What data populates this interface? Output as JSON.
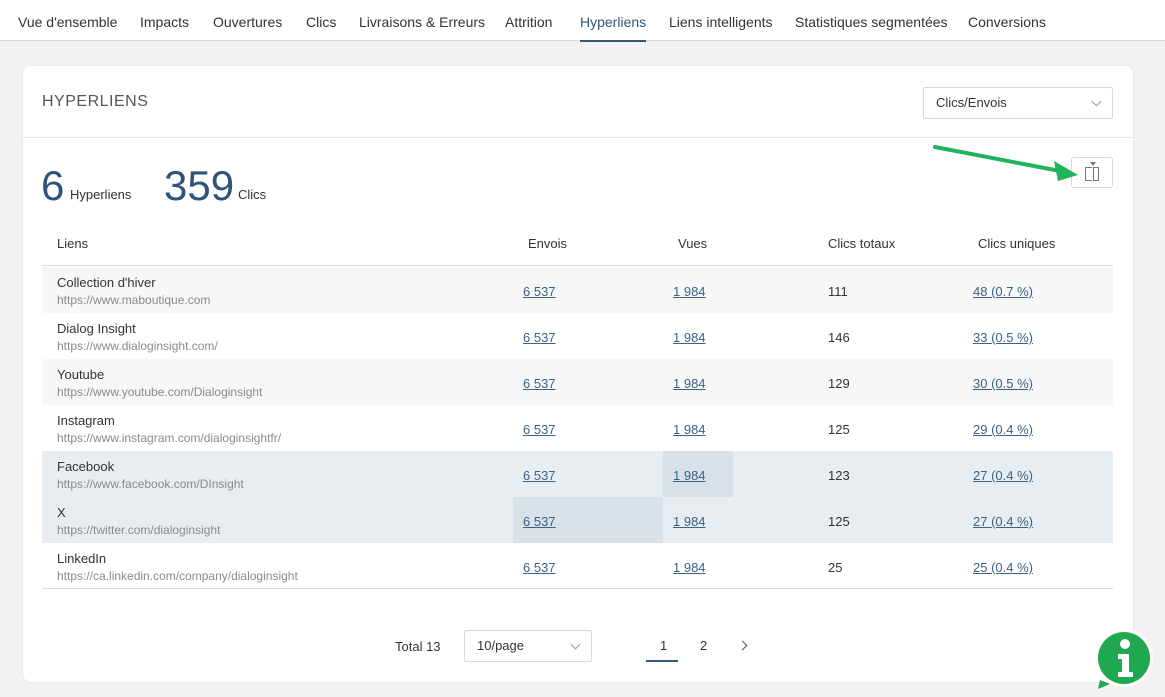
{
  "nav": {
    "tabs": [
      {
        "label": "Vue d'ensemble"
      },
      {
        "label": "Impacts"
      },
      {
        "label": "Ouvertures"
      },
      {
        "label": "Clics"
      },
      {
        "label": "Livraisons & Erreurs"
      },
      {
        "label": "Attrition"
      },
      {
        "label": "Hyperliens"
      },
      {
        "label": "Liens intelligents"
      },
      {
        "label": "Statistiques segmentées"
      },
      {
        "label": "Conversions"
      }
    ],
    "active_tab": "Hyperliens"
  },
  "panel": {
    "title": "HYPERLIENS",
    "metric_select": "Clics/Envois",
    "column_button_icon": "columns-icon"
  },
  "stats": {
    "links_count": "6",
    "links_label": "Hyperliens",
    "clicks_count": "359",
    "clicks_label": "Clics"
  },
  "table": {
    "headers": {
      "links": "Liens",
      "sends": "Envois",
      "views": "Vues",
      "total_clicks": "Clics totaux",
      "unique_clicks": "Clics uniques"
    },
    "rows": [
      {
        "name": "Collection d'hiver",
        "url": "https://www.maboutique.com",
        "sends": "6 537",
        "views": "1 984",
        "total_clicks": "111",
        "unique_clicks": "48 (0.7 %)"
      },
      {
        "name": "Dialog Insight",
        "url": "https://www.dialoginsight.com/",
        "sends": "6 537",
        "views": "1 984",
        "total_clicks": "146",
        "unique_clicks": "33 (0.5 %)"
      },
      {
        "name": "Youtube",
        "url": "https://www.youtube.com/Dialoginsight",
        "sends": "6 537",
        "views": "1 984",
        "total_clicks": "129",
        "unique_clicks": "30 (0.5 %)"
      },
      {
        "name": "Instagram",
        "url": "https://www.instagram.com/dialoginsightfr/",
        "sends": "6 537",
        "views": "1 984",
        "total_clicks": "125",
        "unique_clicks": "29 (0.4 %)"
      },
      {
        "name": "Facebook",
        "url": "https://www.facebook.com/DInsight",
        "sends": "6 537",
        "views": "1 984",
        "total_clicks": "123",
        "unique_clicks": "27 (0.4 %)"
      },
      {
        "name": "X",
        "url": "https://twitter.com/dialoginsight",
        "sends": "6 537",
        "views": "1 984",
        "total_clicks": "125",
        "unique_clicks": "27 (0.4 %)"
      },
      {
        "name": "LinkedIn",
        "url": "https://ca.linkedin.com/company/dialoginsight",
        "sends": "6 537",
        "views": "1 984",
        "total_clicks": "25",
        "unique_clicks": "25 (0.4 %)"
      }
    ]
  },
  "pagination": {
    "total": "Total 13",
    "page_size": "10/page",
    "pages": [
      "1",
      "2"
    ],
    "current_page": "1"
  },
  "colors": {
    "accent": "#34567a",
    "stat_number": "#2f5479",
    "link": "#3b6288",
    "annotation_arrow": "#22b35e",
    "help_button": "#1fa84f"
  }
}
